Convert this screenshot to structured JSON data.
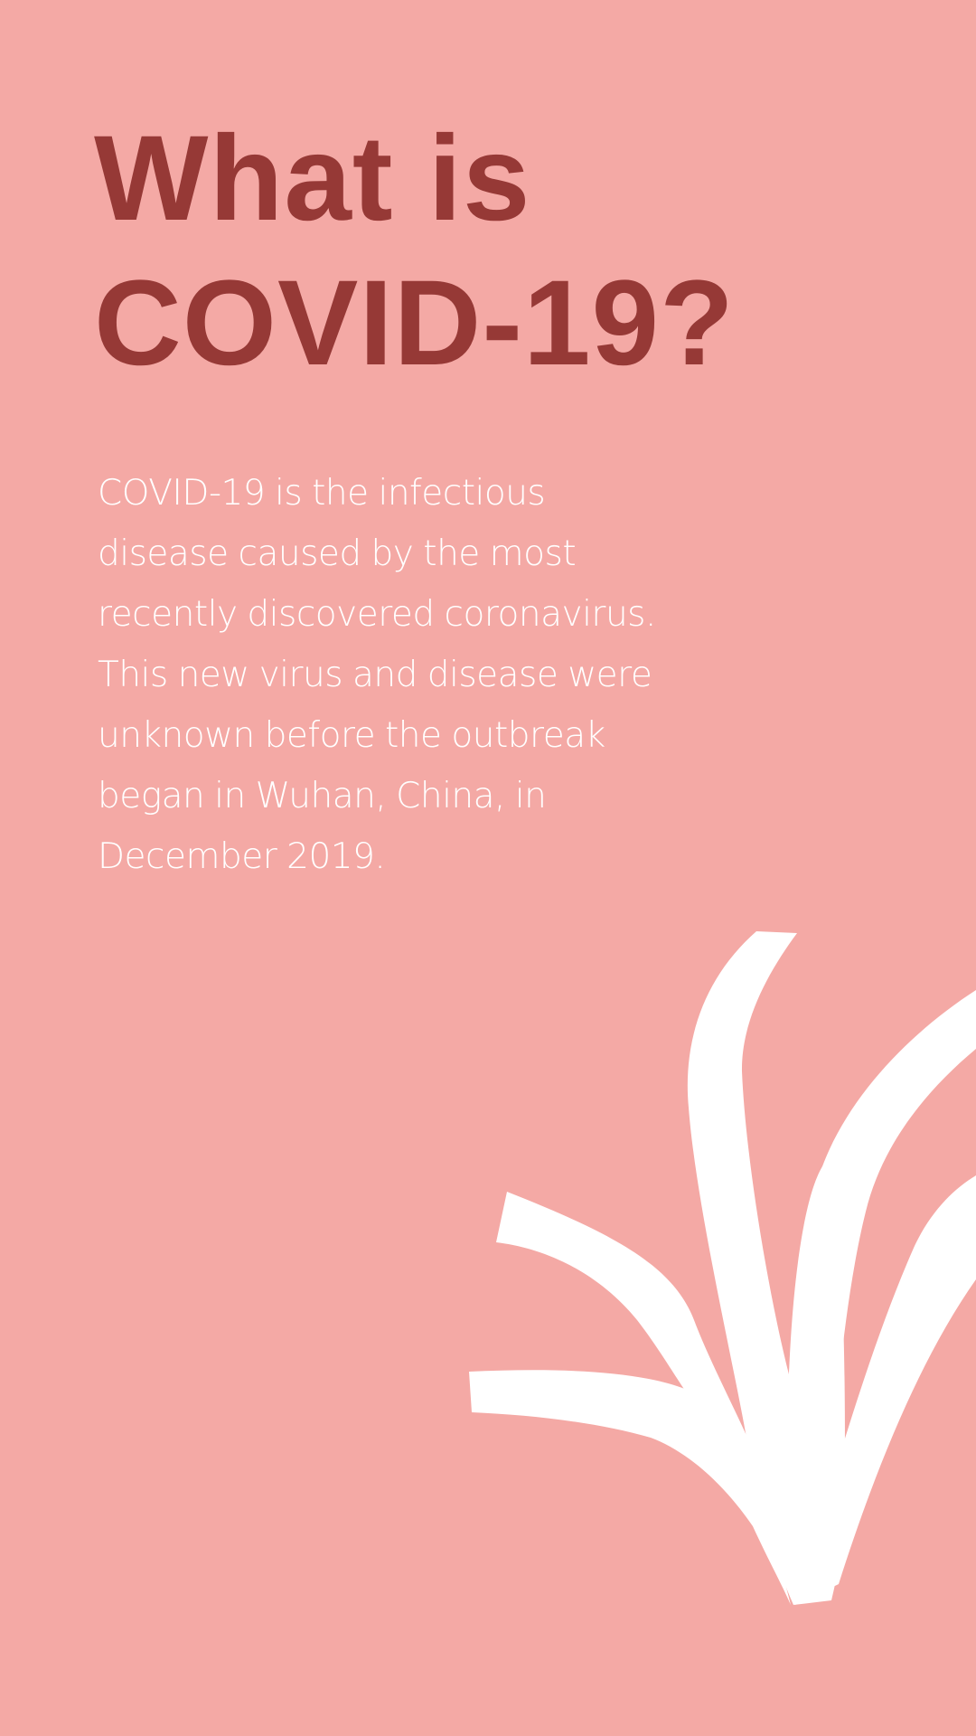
{
  "colors": {
    "background": "#F4A9A5",
    "title": "#963936",
    "body_text": "#FFFFFF",
    "illustration": "#FFFFFF"
  },
  "title": {
    "line1": "What is",
    "line2": "COVID-19?"
  },
  "body": {
    "paragraph": "COVID-19 is the infectious disease caused by the most recently discovered coronavirus. This new virus and disease were unknown before the outbreak began in Wuhan, China, in December 2019."
  },
  "illustration": {
    "icon": "plant-leaves-icon"
  }
}
